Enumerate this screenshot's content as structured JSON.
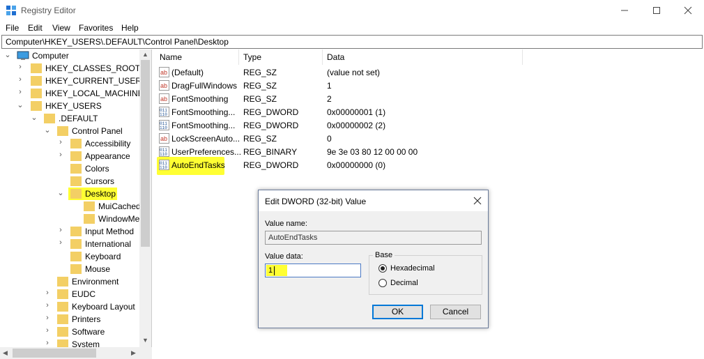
{
  "window": {
    "title": "Registry Editor"
  },
  "menu": [
    "File",
    "Edit",
    "View",
    "Favorites",
    "Help"
  ],
  "address": "Computer\\HKEY_USERS\\.DEFAULT\\Control Panel\\Desktop",
  "tree": {
    "root": "Computer",
    "nodes": {
      "hkcr": "HKEY_CLASSES_ROOT",
      "hkcu": "HKEY_CURRENT_USER",
      "hklm": "HKEY_LOCAL_MACHINE",
      "hku": "HKEY_USERS",
      "default": ".DEFAULT",
      "control_panel": "Control Panel",
      "accessibility": "Accessibility",
      "appearance": "Appearance",
      "colors": "Colors",
      "cursors": "Cursors",
      "desktop": "Desktop",
      "muicached": "MuiCached",
      "windowmetrics": "WindowMetrics",
      "input_method": "Input Method",
      "international": "International",
      "keyboard": "Keyboard",
      "mouse": "Mouse",
      "environment": "Environment",
      "eudc": "EUDC",
      "keyboard_layout": "Keyboard Layout",
      "printers": "Printers",
      "software": "Software",
      "system": "System"
    }
  },
  "list": {
    "columns": {
      "name": "Name",
      "type": "Type",
      "data": "Data"
    },
    "rows": [
      {
        "name": "(Default)",
        "type": "REG_SZ",
        "data": "(value not set)",
        "icon": "string-value-icon"
      },
      {
        "name": "DragFullWindows",
        "type": "REG_SZ",
        "data": "1",
        "icon": "string-value-icon"
      },
      {
        "name": "FontSmoothing",
        "type": "REG_SZ",
        "data": "2",
        "icon": "string-value-icon"
      },
      {
        "name": "FontSmoothing...",
        "type": "REG_DWORD",
        "data": "0x00000001 (1)",
        "icon": "binary-value-icon"
      },
      {
        "name": "FontSmoothing...",
        "type": "REG_DWORD",
        "data": "0x00000002 (2)",
        "icon": "binary-value-icon"
      },
      {
        "name": "LockScreenAuto...",
        "type": "REG_SZ",
        "data": "0",
        "icon": "string-value-icon"
      },
      {
        "name": "UserPreferences...",
        "type": "REG_BINARY",
        "data": "9e 3e 03 80 12 00 00 00",
        "icon": "binary-value-icon"
      },
      {
        "name": "AutoEndTasks",
        "type": "REG_DWORD",
        "data": "0x00000000 (0)",
        "icon": "binary-value-icon"
      }
    ]
  },
  "dialog": {
    "title": "Edit DWORD (32-bit) Value",
    "value_name_label": "Value name:",
    "value_name": "AutoEndTasks",
    "value_data_label": "Value data:",
    "value_data": "1",
    "base_label": "Base",
    "hex_label": "Hexadecimal",
    "dec_label": "Decimal",
    "selected_base": "Hexadecimal",
    "ok_label": "OK",
    "cancel_label": "Cancel"
  },
  "colors": {
    "highlight": "#ffff33",
    "focus": "#0078d7",
    "folder": "#f3cf65"
  }
}
